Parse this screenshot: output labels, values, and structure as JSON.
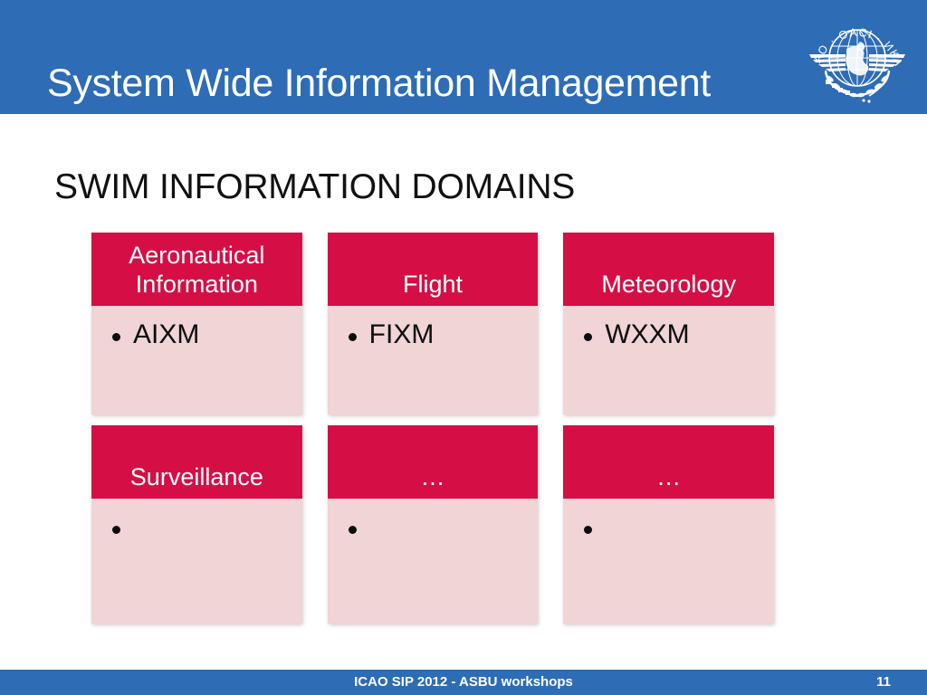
{
  "slide": {
    "title": "System Wide Information Management",
    "heading": "SWIM INFORMATION DOMAINS",
    "logo_name": "icao-logo",
    "logo_text": {
      "arc": "ICAO · OACI · ИКАО",
      "chinese": "国际民航组织",
      "arabic": "إيكاو"
    },
    "colors": {
      "header_blue": "#2E6CB5",
      "card_header_crimson": "#D50F45",
      "card_body_pink": "#F0D4D6",
      "title_text": "#FFFFFF",
      "heading_text": "#111111"
    }
  },
  "domains": {
    "row1": [
      {
        "title": "Aeronautical Information",
        "two_line": true,
        "bullets": [
          "AIXM"
        ]
      },
      {
        "title": "Flight",
        "two_line": false,
        "bullets": [
          "FIXM"
        ]
      },
      {
        "title": "Meteorology",
        "two_line": false,
        "bullets": [
          "WXXM"
        ]
      }
    ],
    "row2": [
      {
        "title": "Surveillance",
        "two_line": false,
        "bullets": [
          ""
        ]
      },
      {
        "title": "…",
        "two_line": false,
        "bullets": [
          ""
        ]
      },
      {
        "title": "…",
        "two_line": false,
        "bullets": [
          ""
        ]
      }
    ]
  },
  "footer": {
    "text": "ICAO SIP 2012 - ASBU workshops",
    "page_number": "11"
  }
}
